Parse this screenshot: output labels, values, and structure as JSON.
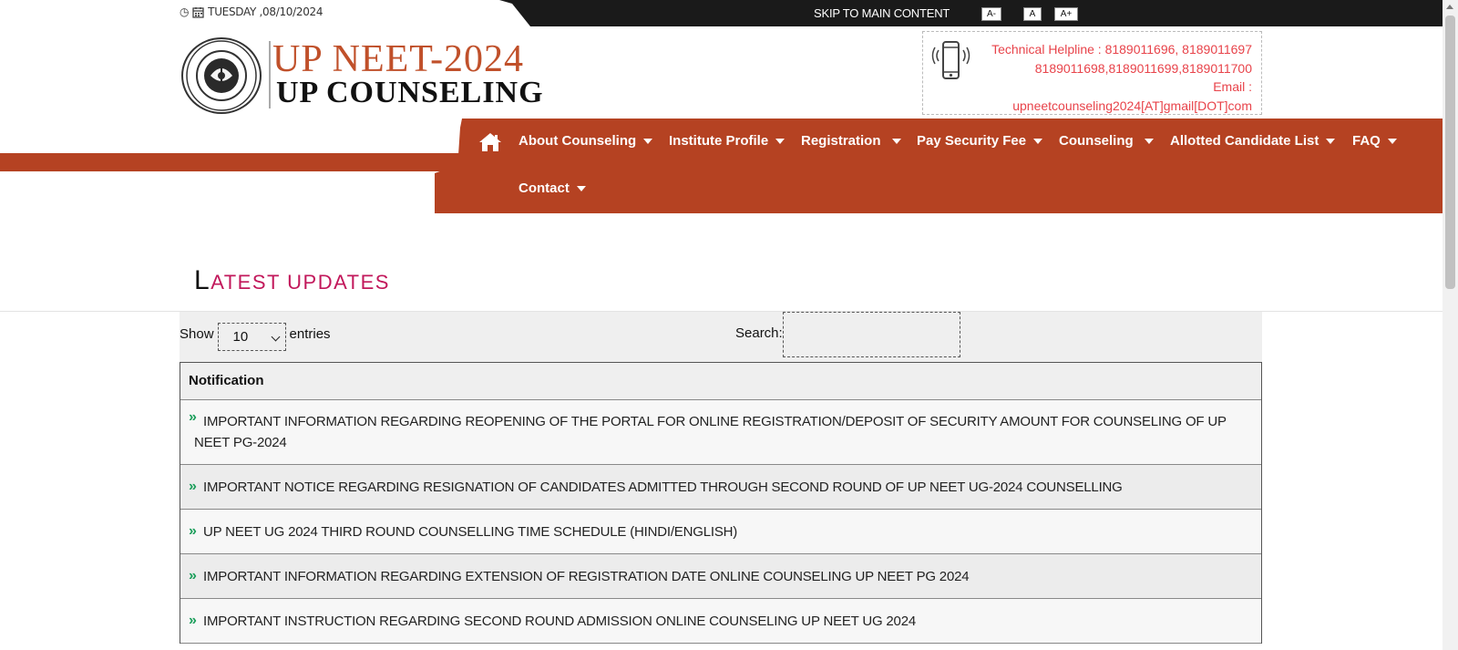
{
  "topbar": {
    "date": "TUESDAY ,08/10/2024",
    "skip_link": "SKIP TO MAIN CONTENT",
    "font_small": "A-",
    "font_normal": "A",
    "font_large": "A+"
  },
  "header": {
    "logo_title": "UP NEET-2024",
    "logo_subtitle": "UP COUNSELING",
    "helpline_line1": "Technical Helpline : 8189011696, 8189011697",
    "helpline_line2": "8189011698,8189011699,8189011700",
    "email_label": "Email :",
    "email_value": "upneetcounseling2024[AT]gmail[DOT]com"
  },
  "nav": {
    "items": [
      {
        "label": "About Counseling"
      },
      {
        "label": "Institute Profile"
      },
      {
        "label": "Registration"
      },
      {
        "label": "Pay Security Fee"
      },
      {
        "label": "Counseling"
      },
      {
        "label": "Allotted Candidate List"
      },
      {
        "label": "FAQ"
      },
      {
        "label": "Contact"
      }
    ]
  },
  "updates": {
    "title_cap": "L",
    "title_rest": "ATEST UPDATES",
    "show_label": "Show",
    "entries_value": "10",
    "entries_label": "entries",
    "search_label": "Search:",
    "column_header": "Notification",
    "rows": [
      {
        "text": "IMPORTANT INFORMATION REGARDING REOPENING OF THE PORTAL FOR ONLINE REGISTRATION/DEPOSIT OF SECURITY AMOUNT FOR COUNSELING OF UP NEET PG-2024"
      },
      {
        "text": "IMPORTANT NOTICE REGARDING RESIGNATION OF CANDIDATES ADMITTED THROUGH SECOND ROUND OF UP NEET UG-2024 COUNSELLING"
      },
      {
        "text": "UP NEET UG 2024 THIRD ROUND COUNSELLING TIME SCHEDULE (HINDI/ENGLISH)"
      },
      {
        "text": "IMPORTANT INFORMATION REGARDING EXTENSION OF REGISTRATION DATE ONLINE COUNSELING UP NEET PG 2024"
      },
      {
        "text": "IMPORTANT INSTRUCTION REGARDING SECOND ROUND ADMISSION ONLINE COUNSELING UP NEET UG 2024"
      }
    ]
  },
  "colors": {
    "brand": "#b54222",
    "title_accent": "#c2185b",
    "helpline": "#e8434a",
    "bullet": "#1a9e5a"
  }
}
